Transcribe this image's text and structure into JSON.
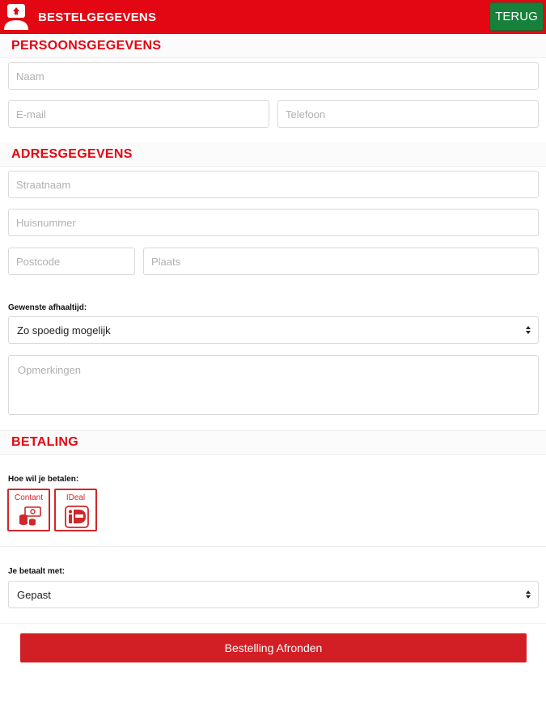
{
  "header": {
    "title": "BESTELGEGEVENS",
    "back_label": "TERUG"
  },
  "personal": {
    "heading": "PERSOONSGEGEVENS",
    "name_placeholder": "Naam",
    "email_placeholder": "E-mail",
    "phone_placeholder": "Telefoon"
  },
  "address": {
    "heading": "ADRESGEGEVENS",
    "street_placeholder": "Straatnaam",
    "housenumber_placeholder": "Huisnummer",
    "postcode_placeholder": "Postcode",
    "city_placeholder": "Plaats"
  },
  "pickup": {
    "label": "Gewenste afhaaltijd:",
    "selected": "Zo spoedig mogelijk"
  },
  "remarks": {
    "placeholder": "Opmerkingen"
  },
  "payment": {
    "heading": "BETALING",
    "method_label": "Hoe wil je betalen:",
    "options": [
      {
        "label": "Contant",
        "icon": "cash-icon"
      },
      {
        "label": "IDeal",
        "icon": "ideal-icon"
      }
    ],
    "paywith_label": "Je betaalt met:",
    "paywith_selected": "Gepast"
  },
  "submit_label": "Bestelling Afronden",
  "colors": {
    "brand_red": "#e30613",
    "back_green": "#17803a",
    "submit_red": "#d21f25"
  }
}
